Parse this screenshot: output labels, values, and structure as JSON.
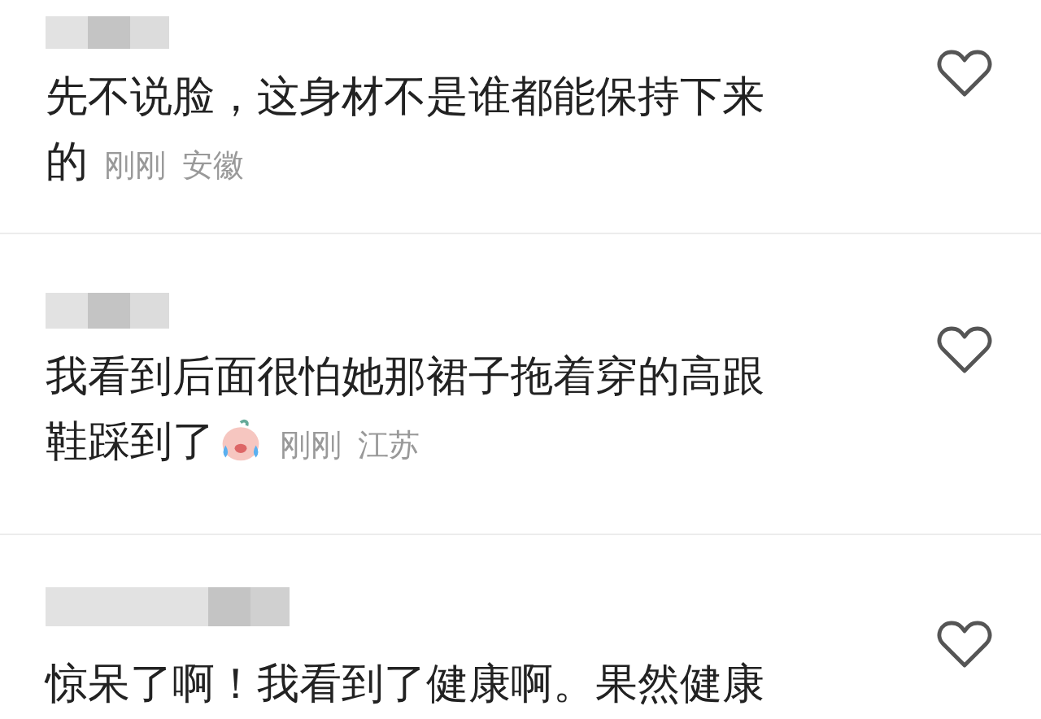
{
  "comments": [
    {
      "text": "先不说脸，这身材不是谁都能保持下来的",
      "emoji": false,
      "time": "刚刚",
      "location": "安徽",
      "liked": false
    },
    {
      "text": "我看到后面很怕她那裙子拖着穿的高跟鞋踩到了",
      "emoji": true,
      "time": "刚刚",
      "location": "江苏",
      "liked": false
    },
    {
      "text": "惊呆了啊！我看到了健康啊。果然健康",
      "emoji": false,
      "liked": false
    }
  ]
}
